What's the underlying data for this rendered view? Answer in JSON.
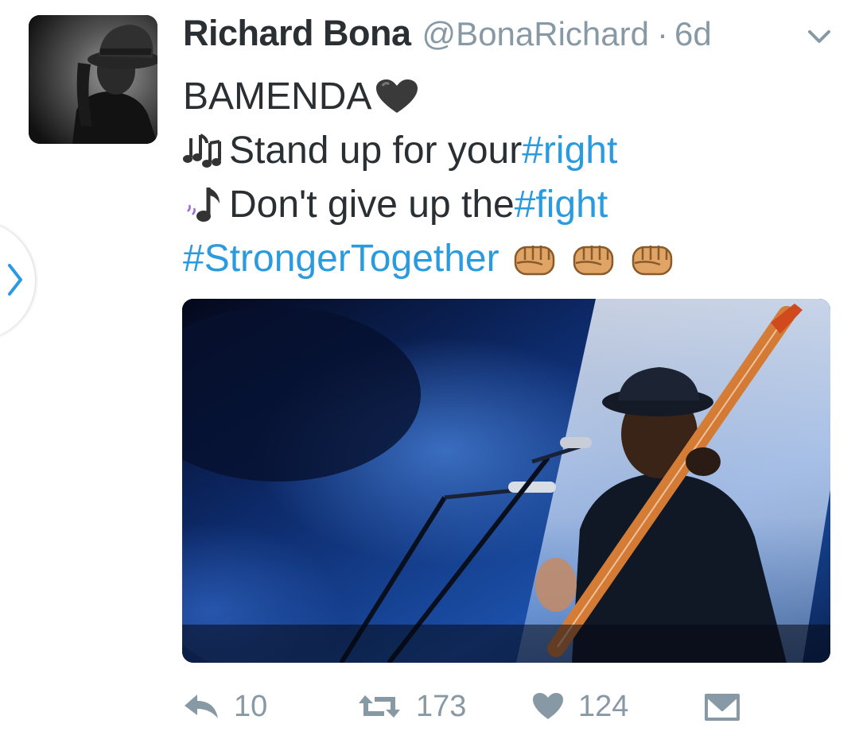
{
  "tweet": {
    "display_name": "Richard Bona",
    "handle": "@BonaRichard",
    "separator": "·",
    "time": "6d",
    "lines": {
      "line1": "BAMENDA",
      "line2_text": "Stand up for your ",
      "line2_hashtag": "#right",
      "line3_text": "Don't give up the ",
      "line3_hashtag": "#fight",
      "line4_hashtag": "#StrongerTogether"
    },
    "emoji": {
      "heart": "black-heart",
      "notes": "multiple-musical-notes",
      "note": "musical-note",
      "fist": "oncoming-fist"
    }
  },
  "actions": {
    "reply_count": "10",
    "retweet_count": "173",
    "like_count": "124"
  },
  "colors": {
    "hashtag": "#2b9be0",
    "meta": "#8899a6",
    "text": "#292f33"
  },
  "icons": [
    "chevron-right-icon",
    "caret-down-icon",
    "reply-icon",
    "retweet-icon",
    "heart-icon",
    "direct-message-icon"
  ]
}
